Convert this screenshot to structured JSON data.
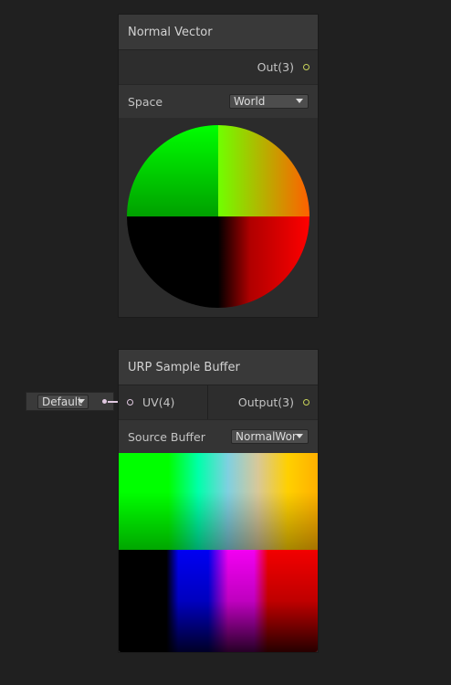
{
  "node1": {
    "title": "Normal Vector",
    "output_port": "Out(3)",
    "space_label": "Space",
    "space_value": "World"
  },
  "node2": {
    "title": "URP Sample Buffer",
    "input_port": "UV(4)",
    "output_port": "Output(3)",
    "source_label": "Source Buffer",
    "source_value": "NormalWorl"
  },
  "uv_input": {
    "value": "Default"
  },
  "colors": {
    "background": "#202020",
    "port_vector3": "#c8d35a",
    "port_vector4": "#e0c8e0"
  }
}
